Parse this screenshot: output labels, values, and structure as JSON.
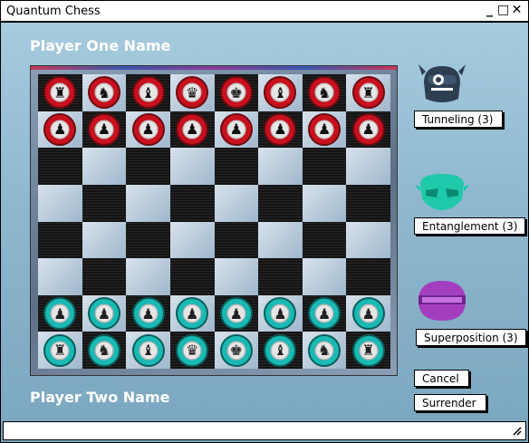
{
  "window": {
    "title": "Quantum Chess",
    "controls": [
      "_",
      "□",
      "✕"
    ]
  },
  "players": {
    "one": "Player One Name",
    "two": "Player Two Name"
  },
  "board": {
    "rows": [
      [
        "rook-red",
        "knight-red",
        "bishop-red",
        "queen-red",
        "king-red",
        "bishop-red",
        "knight-red",
        "rook-red"
      ],
      [
        "pawn-red",
        "pawn-red",
        "pawn-red",
        "pawn-red",
        "pawn-red",
        "pawn-red",
        "pawn-red",
        "pawn-red"
      ],
      [
        "",
        "",
        "",
        "",
        "",
        "",
        "",
        ""
      ],
      [
        "",
        "",
        "",
        "",
        "",
        "",
        "",
        ""
      ],
      [
        "",
        "",
        "",
        "",
        "",
        "",
        "",
        ""
      ],
      [
        "",
        "",
        "",
        "",
        "",
        "",
        "",
        ""
      ],
      [
        "pawn-teal",
        "pawn-teal",
        "pawn-teal",
        "pawn-teal",
        "pawn-teal",
        "pawn-teal",
        "pawn-teal",
        "pawn-teal"
      ],
      [
        "rook-teal",
        "knight-teal",
        "bishop-teal",
        "queen-teal",
        "king-teal",
        "bishop-teal",
        "knight-teal",
        "rook-teal"
      ]
    ]
  },
  "powers": {
    "tunneling": {
      "label": "Tunneling (3)",
      "icon": "masked-head-icon",
      "color": "#2c3e50"
    },
    "entanglement": {
      "label": "Entanglement (3)",
      "icon": "green-mask-icon",
      "color": "#1fc9a9"
    },
    "superposition": {
      "label": "Superposition (3)",
      "icon": "purple-helmet-icon",
      "color": "#a33fbf"
    }
  },
  "actions": {
    "cancel": "Cancel",
    "surrender": "Surrender"
  },
  "status": {
    "value": "",
    "placeholder": ""
  }
}
